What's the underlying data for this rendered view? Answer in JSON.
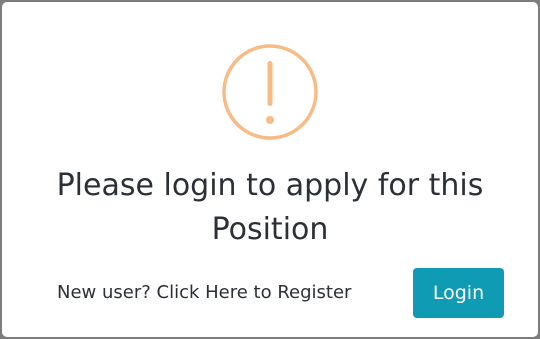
{
  "dialog": {
    "title": "Please login to apply for this Position",
    "icon": "exclamation-circle-icon",
    "icon_color": "#f8bb86",
    "register_text": "New user? Click Here to Register",
    "login_label": "Login",
    "login_color": "#0f9bb4"
  }
}
